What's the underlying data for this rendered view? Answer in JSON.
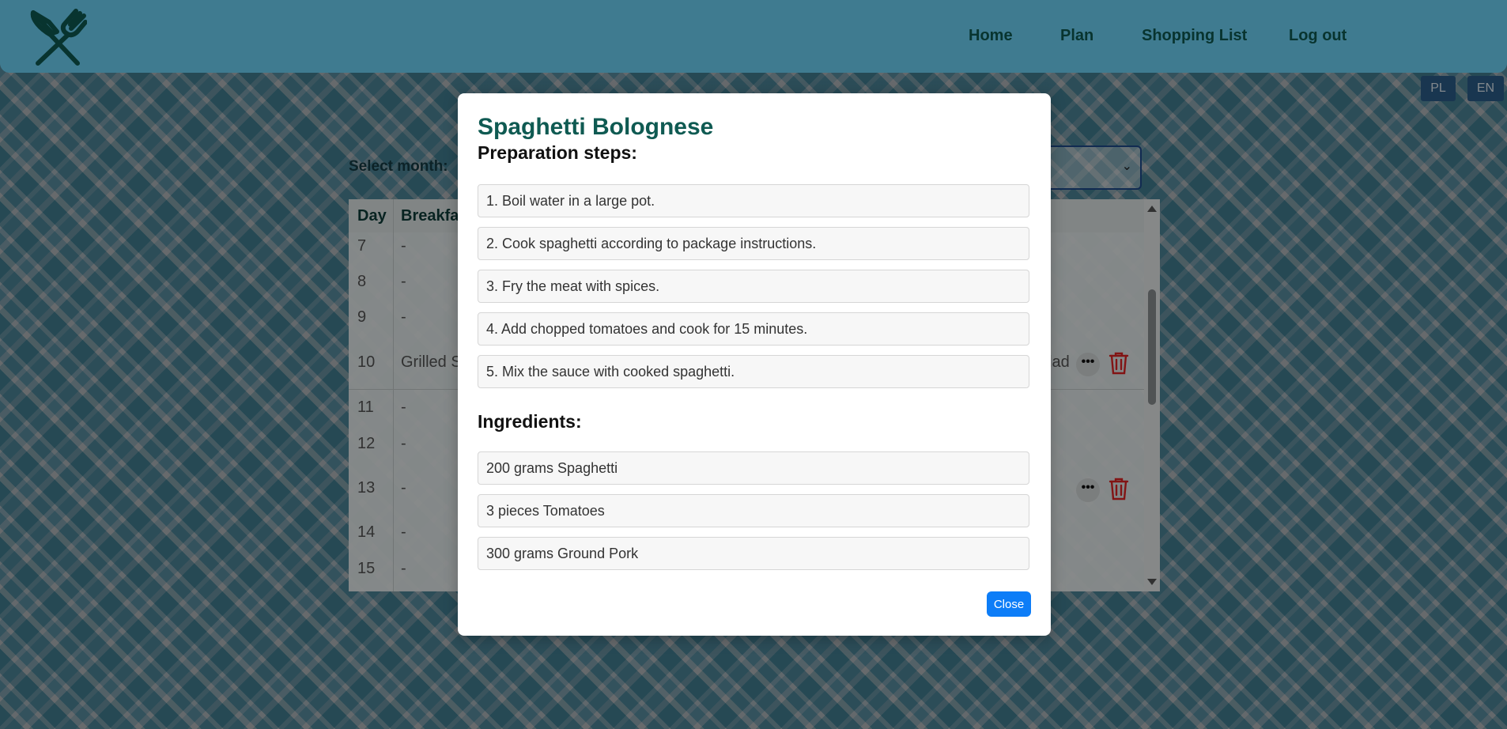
{
  "nav": {
    "logo_icon": "fork-knife-crossed-icon",
    "links": [
      "Home",
      "Plan",
      "Shopping List",
      "Log out"
    ]
  },
  "languages": [
    "PL",
    "EN"
  ],
  "plan": {
    "select_month_label": "Select month:",
    "columns": {
      "day": "Day",
      "breakfast": "Breakfa"
    },
    "rows": [
      {
        "day": "7",
        "meal": "-"
      },
      {
        "day": "8",
        "meal": "-"
      },
      {
        "day": "9",
        "meal": "-"
      },
      {
        "day": "10",
        "meal": "Grilled S",
        "meal_right": "lad"
      },
      {
        "day": "11",
        "meal": "-"
      },
      {
        "day": "12",
        "meal": "-"
      },
      {
        "day": "13",
        "meal": "-"
      },
      {
        "day": "14",
        "meal": "-"
      },
      {
        "day": "15",
        "meal": "-"
      }
    ],
    "more_label": "•••"
  },
  "modal": {
    "title": "Spaghetti Bolognese",
    "steps_heading": "Preparation steps:",
    "steps": [
      "1. Boil water in a large pot.",
      "2. Cook spaghetti according to package instructions.",
      "3. Fry the meat with spices.",
      "4. Add chopped tomatoes and cook for 15 minutes.",
      "5. Mix the sauce with cooked spaghetti."
    ],
    "ingredients_heading": "Ingredients:",
    "ingredients": [
      "200 grams Spaghetti",
      "3 pieces Tomatoes",
      "300 grams Ground Pork"
    ],
    "close_label": "Close"
  },
  "colors": {
    "header": "#6dd5f8",
    "title": "#0f5a52",
    "close_button": "#0d7df7",
    "delete_icon": "#e02424",
    "lang_button": "#2b5e8a"
  }
}
